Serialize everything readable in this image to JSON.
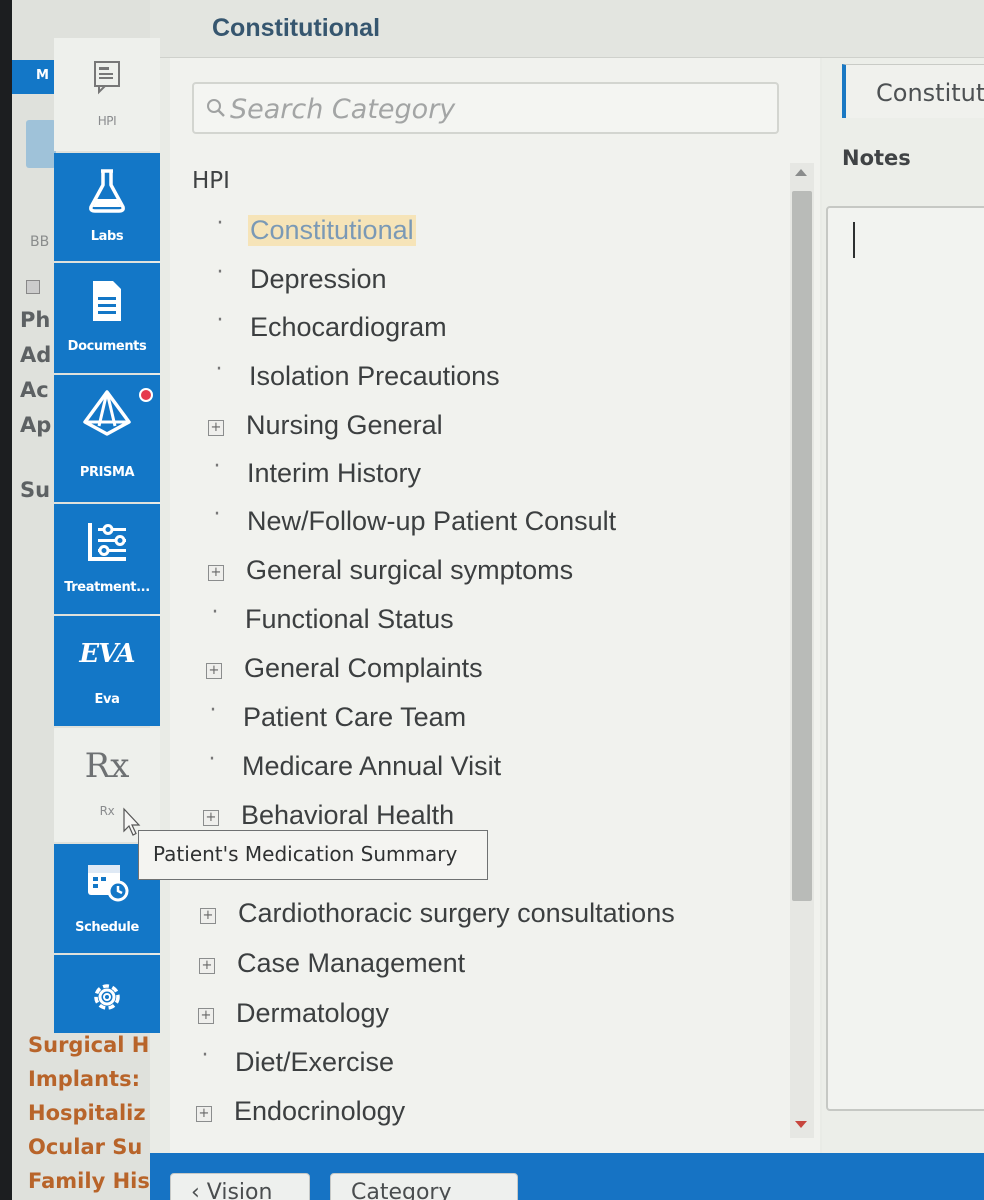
{
  "background_app": {
    "tab_label": "M",
    "filter_label": "BB",
    "fragments": [
      "Ph",
      "Ad",
      "Ac",
      "Ap",
      "Su"
    ],
    "history_labels": [
      "Surgical H",
      "Implants:",
      "Hospitaliz",
      "Ocular Su",
      "Family His"
    ]
  },
  "nav_rail": {
    "items": [
      {
        "label": "HPI",
        "icon": "clipboard-note-icon"
      },
      {
        "label": "Labs",
        "icon": "flask-icon"
      },
      {
        "label": "Documents",
        "icon": "document-icon"
      },
      {
        "label": "PRISMA",
        "icon": "prism-icon",
        "badge": true
      },
      {
        "label": "Treatment...",
        "icon": "sliders-icon"
      },
      {
        "label": "Eva",
        "icon": "eva-logo",
        "logo_text": "EVA"
      },
      {
        "label": "Rx",
        "icon": "rx-icon",
        "logo_text": "Rx"
      },
      {
        "label": "Schedule",
        "icon": "calendar-clock-icon"
      },
      {
        "label": "",
        "icon": "gear-icon"
      }
    ]
  },
  "dialog": {
    "title": "Constitutional",
    "search": {
      "placeholder": "Search Category",
      "value": ""
    },
    "tree": {
      "root": "HPI",
      "items": [
        {
          "label": "Constitutional",
          "marker": "dash",
          "selected": true
        },
        {
          "label": "Depression",
          "marker": "dash"
        },
        {
          "label": "Echocardiogram",
          "marker": "dash"
        },
        {
          "label": "Isolation Precautions",
          "marker": "dash"
        },
        {
          "label": "Nursing General",
          "marker": "expand"
        },
        {
          "label": "Interim History",
          "marker": "dash"
        },
        {
          "label": "New/Follow-up Patient Consult",
          "marker": "dash"
        },
        {
          "label": "General surgical symptoms",
          "marker": "expand"
        },
        {
          "label": "Functional Status",
          "marker": "dash"
        },
        {
          "label": "General Complaints",
          "marker": "expand"
        },
        {
          "label": "Patient Care Team",
          "marker": "dash"
        },
        {
          "label": "Medicare Annual Visit",
          "marker": "dash"
        },
        {
          "label": "Behavioral Health",
          "marker": "expand"
        },
        {
          "label": "",
          "marker": "expand"
        },
        {
          "label": "Cardiothoracic surgery consultations",
          "marker": "expand"
        },
        {
          "label": "Case Management",
          "marker": "expand"
        },
        {
          "label": "Dermatology",
          "marker": "expand"
        },
        {
          "label": "Diet/Exercise",
          "marker": "dash"
        },
        {
          "label": "Endocrinology",
          "marker": "expand"
        }
      ]
    },
    "right_pane": {
      "tab_label": "Constitut",
      "notes_label": "Notes",
      "notes_value": ""
    },
    "bottom_buttons": [
      {
        "label": "‹ Vision"
      },
      {
        "label": "Category"
      }
    ]
  },
  "tooltip": {
    "text": "Patient's Medication Summary"
  },
  "colors": {
    "nav_blue": "#1377c7",
    "selection_highlight": "#f6e4b8",
    "badge_red": "#e53a4d",
    "history_orange": "#b8642a"
  }
}
